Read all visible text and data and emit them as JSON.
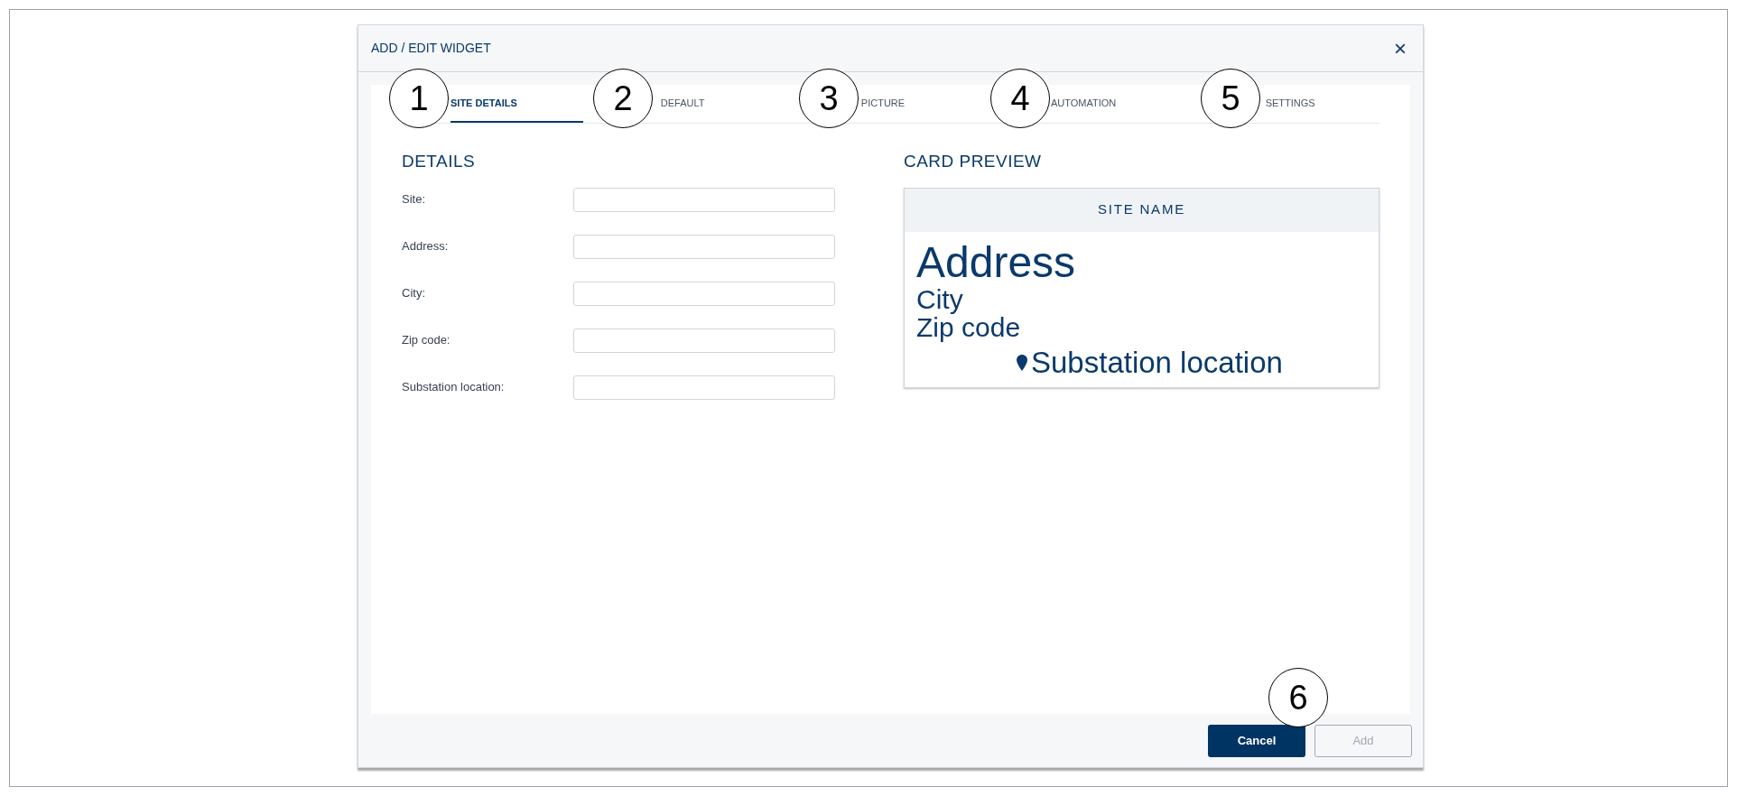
{
  "dialog": {
    "title": "ADD / EDIT WIDGET",
    "close": "×"
  },
  "tabs": [
    {
      "label": "SITE DETAILS",
      "selected": true
    },
    {
      "label": "DEFAULT",
      "selected": false
    },
    {
      "label": "PICTURE",
      "selected": false
    },
    {
      "label": "AUTOMATION",
      "selected": false
    },
    {
      "label": "SETTINGS",
      "selected": false
    }
  ],
  "details": {
    "heading": "DETAILS",
    "fields": [
      {
        "label": "Site:"
      },
      {
        "label": "Address:"
      },
      {
        "label": "City:"
      },
      {
        "label": "Zip code:"
      },
      {
        "label": "Substation location:"
      }
    ]
  },
  "card_preview": {
    "heading": "CARD PREVIEW",
    "site_name": "SITE NAME",
    "address": "Address",
    "city": "City",
    "zip": "Zip code",
    "location": "Substation location"
  },
  "buttons": [
    {
      "label": "Cancel",
      "kind": "primary",
      "disabled": false
    },
    {
      "label": "Add",
      "kind": "secondary",
      "disabled": true
    }
  ],
  "callouts": [
    "1",
    "2",
    "3",
    "4",
    "5",
    "6"
  ]
}
